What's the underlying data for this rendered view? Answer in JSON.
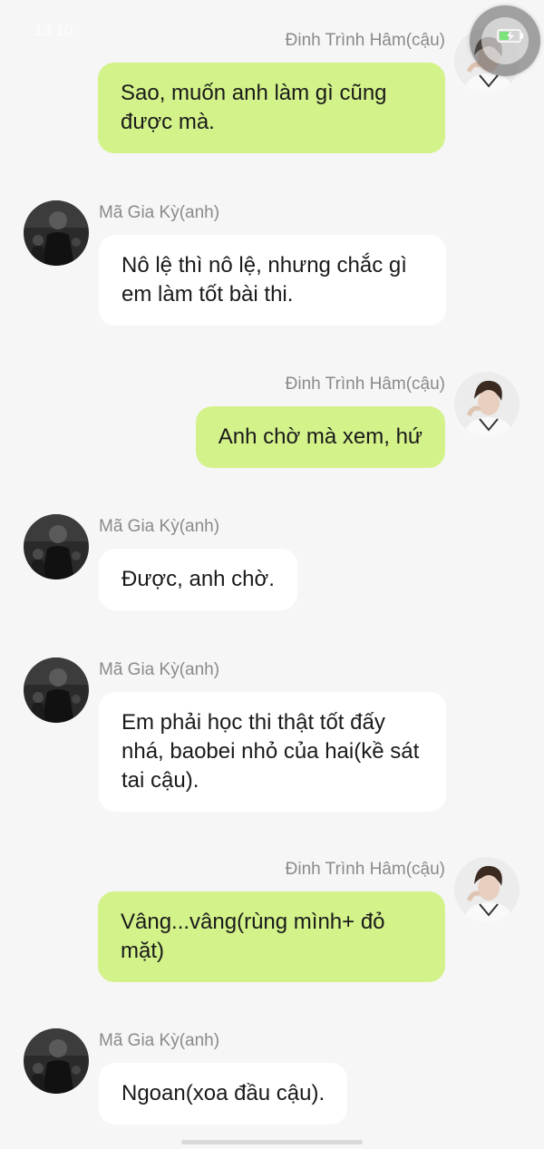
{
  "status_bar": {
    "time": "13:10",
    "battery_icon": "battery-charging-icon"
  },
  "colors": {
    "background": "#f6f6f6",
    "incoming_bubble": "#ffffff",
    "outgoing_bubble": "#d3f28a",
    "name_text": "#8a8a8a"
  },
  "chat": {
    "messages": [
      {
        "sender": "Đinh Trình Hâm(cậu)",
        "side": "right",
        "text": "Sao, muốn anh làm gì cũng được mà."
      },
      {
        "sender": "Mã Gia Kỳ(anh)",
        "side": "left",
        "text": "Nô lệ thì nô lệ, nhưng chắc gì em làm tốt bài thi."
      },
      {
        "sender": "Đinh Trình Hâm(cậu)",
        "side": "right",
        "text": "Anh chờ mà xem, hứ"
      },
      {
        "sender": "Mã Gia Kỳ(anh)",
        "side": "left",
        "text": "Được, anh chờ."
      },
      {
        "sender": "Mã Gia Kỳ(anh)",
        "side": "left",
        "text": "Em phải học thi thật tốt đấy nhá, baobei nhỏ của hai(kề sát tai cậu)."
      },
      {
        "sender": "Đinh Trình Hâm(cậu)",
        "side": "right",
        "text": "Vâng...vâng(rùng mình+ đỏ mặt)"
      },
      {
        "sender": "Mã Gia Kỳ(anh)",
        "side": "left",
        "text": "Ngoan(xoa đầu cậu)."
      }
    ]
  }
}
